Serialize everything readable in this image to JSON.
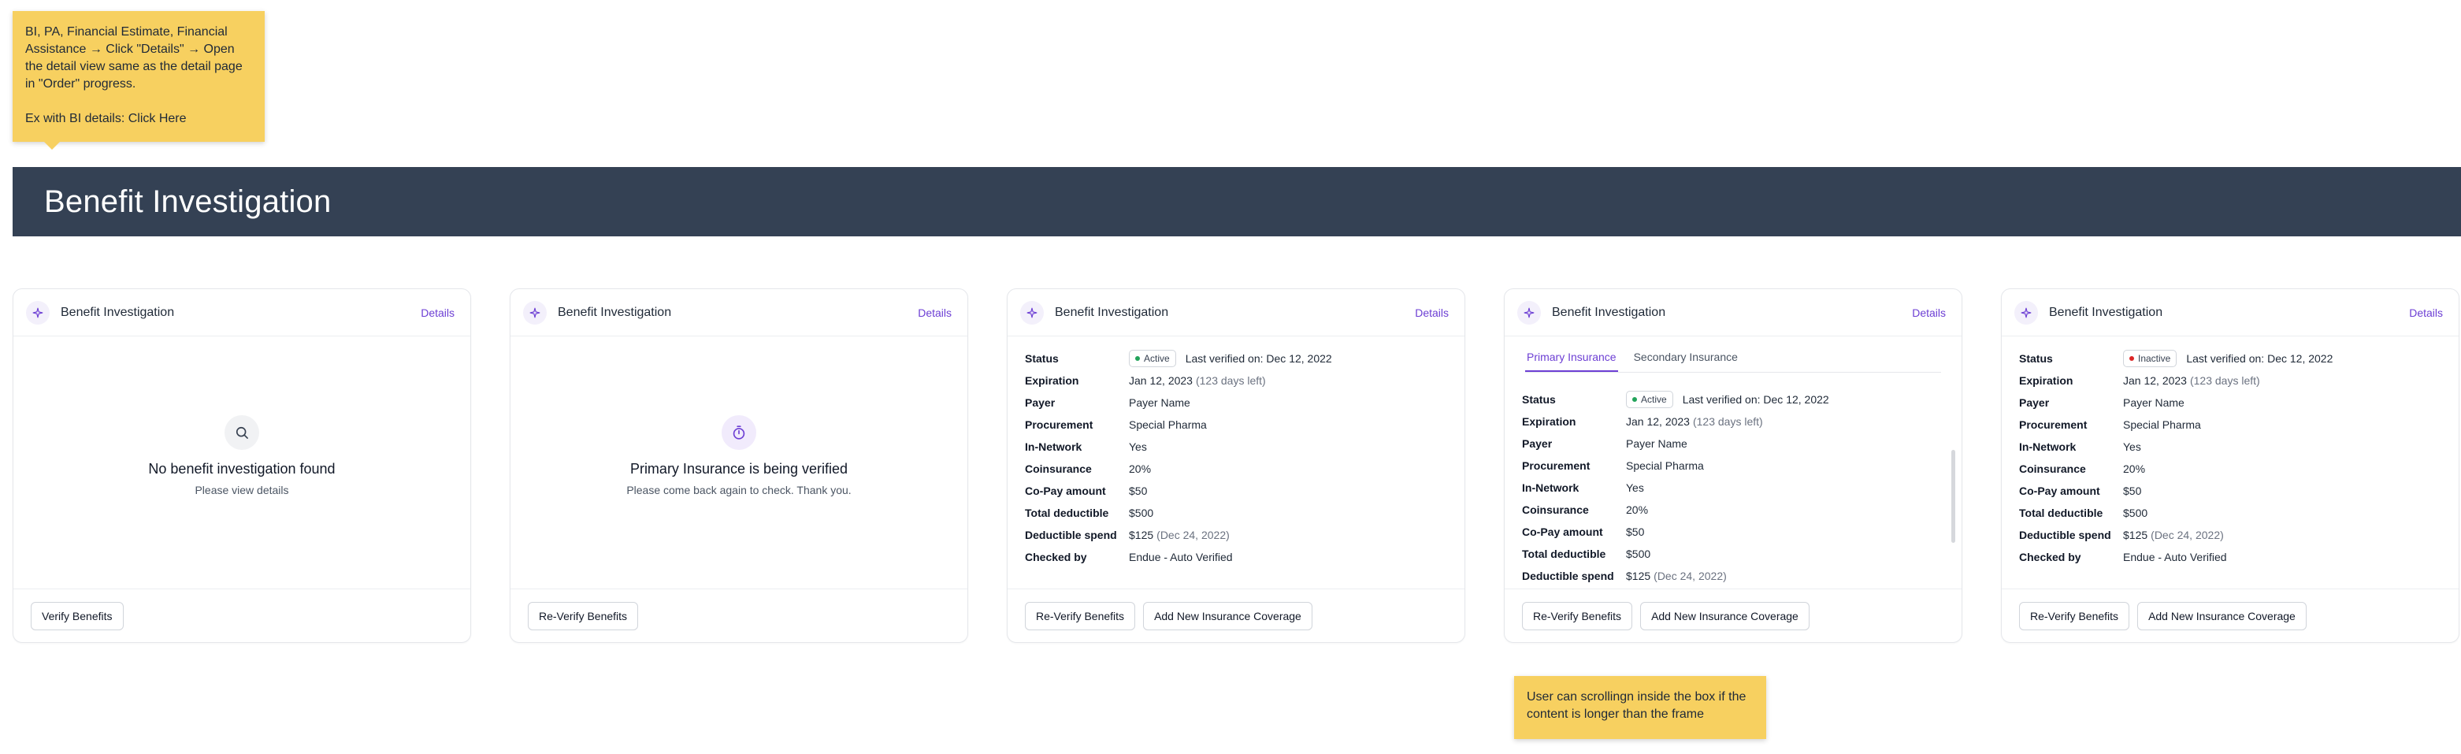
{
  "notes": {
    "top_line1": "BI, PA, Financial Estimate, Financial Assistance → Click \"Details\" → Open the detail view same as the detail page in \"Order\" progress.",
    "top_line2": "Ex with BI details: Click Here",
    "bottom": "User can scrollingn inside the box if the content is longer than the frame"
  },
  "banner": {
    "title": "Benefit Investigation"
  },
  "card_title": "Benefit Investigation",
  "details_label": "Details",
  "icons": {
    "header": "sparkle-icon",
    "search": "search-icon",
    "timer": "stopwatch-icon"
  },
  "colors": {
    "accent": "#6d3fd4",
    "banner": "#344154",
    "note": "#f7d060",
    "active": "#22a35a",
    "inactive": "#dc2626"
  },
  "cards": [
    {
      "empty_title": "No benefit investigation found",
      "empty_sub": "Please view details",
      "buttons": [
        "Verify Benefits"
      ]
    },
    {
      "empty_title": "Primary Insurance is being verified",
      "empty_sub": "Please come back again to check. Thank you.",
      "buttons": [
        "Re-Verify Benefits"
      ]
    },
    {
      "status": "Active",
      "last_verified": "Last verified on: Dec 12, 2022",
      "expiration": "Jan 12, 2023",
      "expiration_note": "(123 days left)",
      "payer": "Payer Name",
      "procurement": "Special Pharma",
      "in_network": "Yes",
      "coinsurance": "20%",
      "copay": "$50",
      "total_deductible": "$500",
      "deductible_spend": "$125",
      "deductible_spend_note": "(Dec 24, 2022)",
      "checked_by": "Endue - Auto Verified",
      "buttons": [
        "Re-Verify Benefits",
        "Add New Insurance Coverage"
      ]
    },
    {
      "tabs": [
        "Primary Insurance",
        "Secondary Insurance"
      ],
      "status": "Active",
      "last_verified": "Last verified on: Dec 12, 2022",
      "expiration": "Jan 12, 2023",
      "expiration_note": "(123 days left)",
      "payer": "Payer Name",
      "procurement": "Special Pharma",
      "in_network": "Yes",
      "coinsurance": "20%",
      "copay": "$50",
      "total_deductible": "$500",
      "deductible_spend": "$125",
      "deductible_spend_note": "(Dec 24, 2022)",
      "buttons": [
        "Re-Verify Benefits",
        "Add New Insurance Coverage"
      ]
    },
    {
      "status": "Inactive",
      "last_verified": "Last verified on: Dec 12, 2022",
      "expiration": "Jan 12, 2023",
      "expiration_note": "(123 days left)",
      "payer": "Payer Name",
      "procurement": "Special Pharma",
      "in_network": "Yes",
      "coinsurance": "20%",
      "copay": "$50",
      "total_deductible": "$500",
      "deductible_spend": "$125",
      "deductible_spend_note": "(Dec 24, 2022)",
      "checked_by": "Endue - Auto Verified",
      "buttons": [
        "Re-Verify Benefits",
        "Add New Insurance Coverage"
      ]
    }
  ],
  "labels": {
    "status": "Status",
    "expiration": "Expiration",
    "payer": "Payer",
    "procurement": "Procurement",
    "in_network": "In-Network",
    "coinsurance": "Coinsurance",
    "copay": "Co-Pay amount",
    "total_deductible": "Total deductible",
    "deductible_spend": "Deductible spend",
    "checked_by": "Checked by"
  }
}
